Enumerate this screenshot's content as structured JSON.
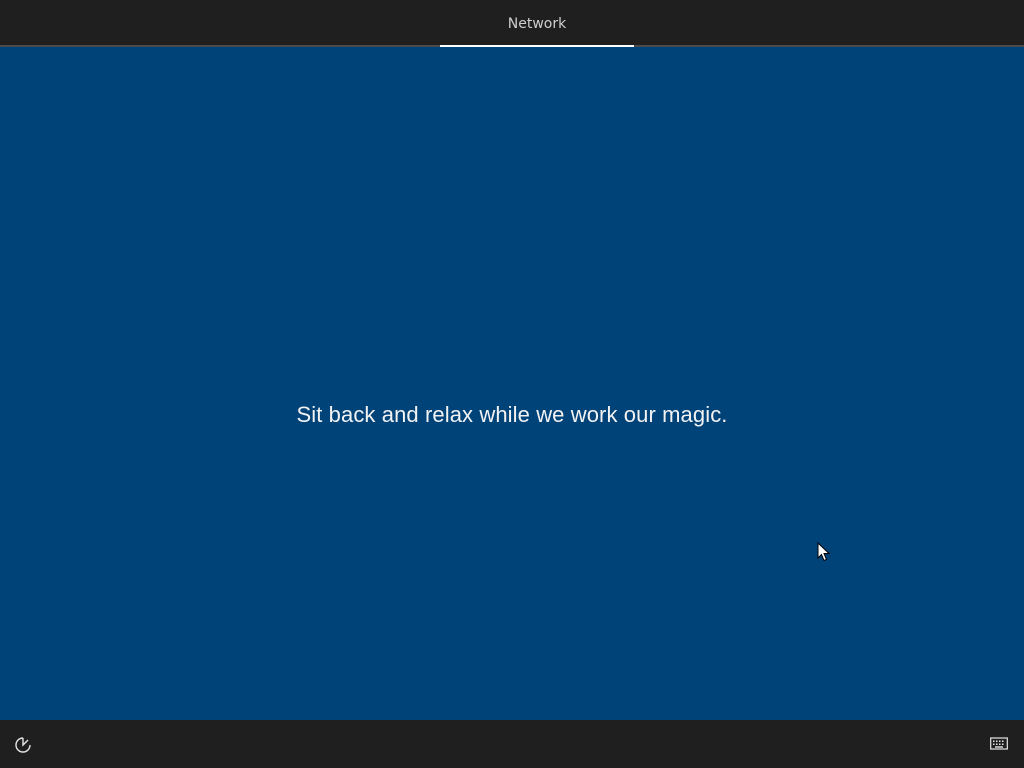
{
  "header": {
    "tabs": [
      {
        "label": "Network",
        "active": true
      }
    ]
  },
  "main": {
    "message": "Sit back and relax while we work our magic."
  },
  "footer": {
    "left_icon": "ease-of-access-icon",
    "right_icon": "keyboard-icon"
  },
  "colors": {
    "background": "#004379",
    "bar": "#1f1f1f",
    "text": "#f2f2f2"
  }
}
